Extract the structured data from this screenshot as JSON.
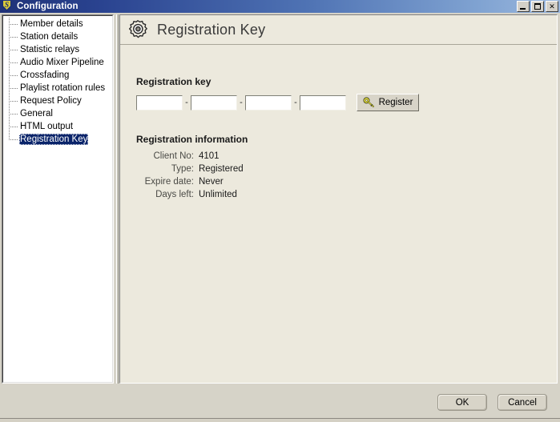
{
  "window": {
    "title": "Configuration",
    "app_icon": "shield-s-icon",
    "controls": {
      "minimize": "minimize-icon",
      "maximize": "maximize-icon",
      "close": "✕"
    }
  },
  "sidebar": {
    "items": [
      {
        "label": "Member details",
        "selected": false
      },
      {
        "label": "Station details",
        "selected": false
      },
      {
        "label": "Statistic relays",
        "selected": false
      },
      {
        "label": "Audio Mixer Pipeline",
        "selected": false
      },
      {
        "label": "Crossfading",
        "selected": false
      },
      {
        "label": "Playlist rotation rules",
        "selected": false
      },
      {
        "label": "Request Policy",
        "selected": false
      },
      {
        "label": "General",
        "selected": false
      },
      {
        "label": "HTML output",
        "selected": false
      },
      {
        "label": "Registration Key",
        "selected": true
      }
    ]
  },
  "panel": {
    "icon": "gear-icon",
    "title": "Registration Key",
    "registration_key": {
      "heading": "Registration key",
      "separator": "-",
      "fields": [
        {
          "name": "key-part-1",
          "value": "",
          "placeholder": ""
        },
        {
          "name": "key-part-2",
          "value": "",
          "placeholder": ""
        },
        {
          "name": "key-part-3",
          "value": "",
          "placeholder": ""
        },
        {
          "name": "key-part-4",
          "value": "",
          "placeholder": ""
        }
      ],
      "register_button": {
        "label": "Register",
        "icon": "key-icon"
      }
    },
    "registration_information": {
      "heading": "Registration information",
      "rows": [
        {
          "label": "Client No:",
          "value": "4101"
        },
        {
          "label": "Type:",
          "value": "Registered"
        },
        {
          "label": "Expire date:",
          "value": "Never"
        },
        {
          "label": "Days left:",
          "value": "Unlimited"
        }
      ]
    }
  },
  "footer": {
    "ok_label": "OK",
    "cancel_label": "Cancel"
  },
  "colors": {
    "titlebar_start": "#1f3278",
    "titlebar_end": "#9bb8de",
    "panel_background": "#ece9dd",
    "dialog_background": "#d6d3c8",
    "selection": "#0a246a",
    "key_icon": "#e8e04a"
  }
}
